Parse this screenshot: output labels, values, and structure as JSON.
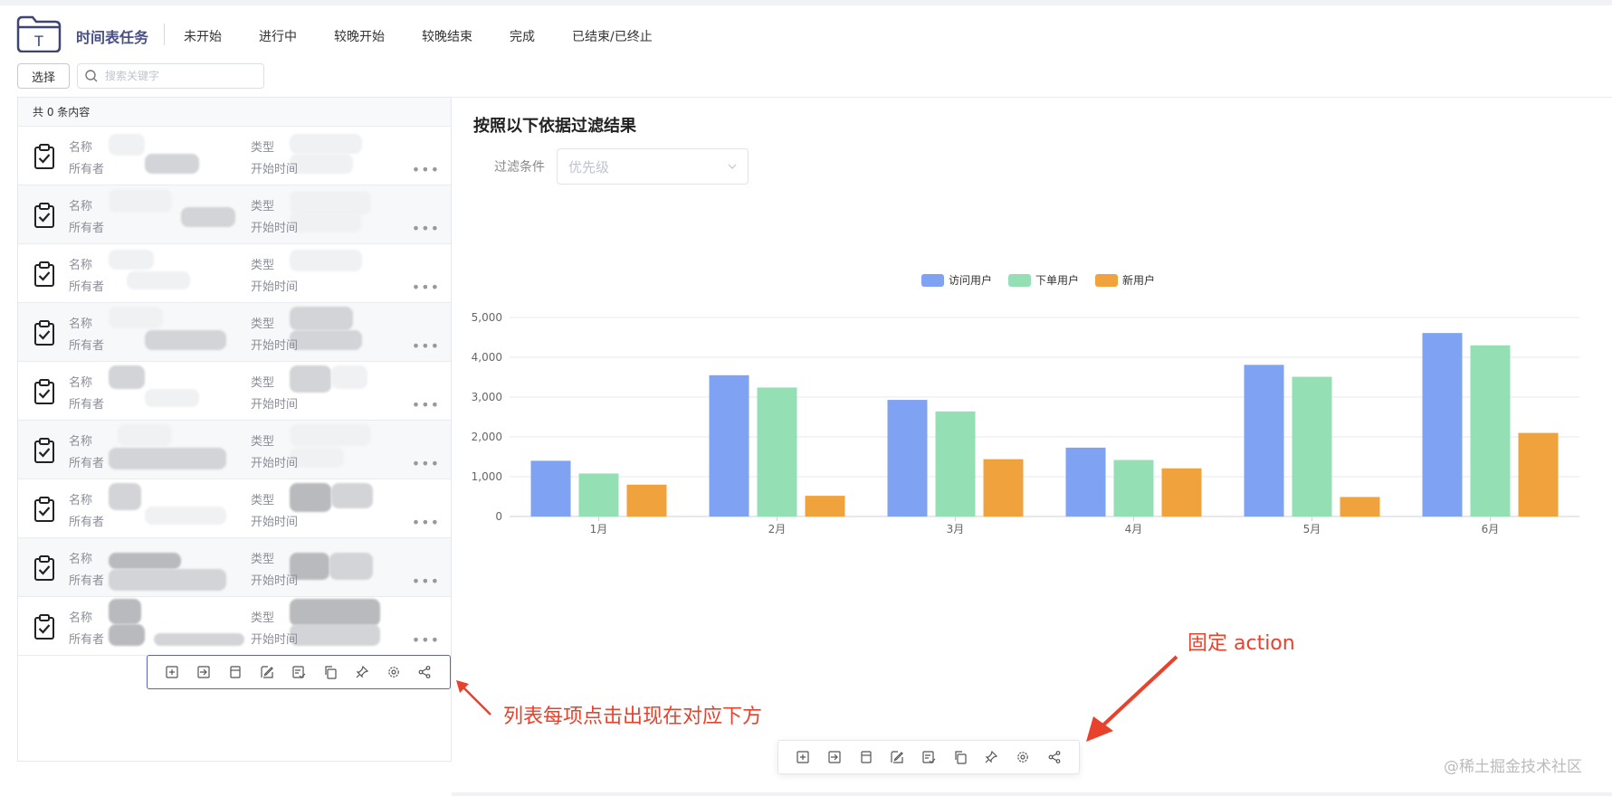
{
  "header": {
    "app_title": "时间表任务",
    "tabs": [
      "未开始",
      "进行中",
      "较晚开始",
      "较晚结束",
      "完成",
      "已结束/已终止"
    ]
  },
  "toolbar": {
    "select_label": "选择",
    "search_placeholder": "搜索关键字"
  },
  "list": {
    "count_text": "共 0 条内容",
    "labels": {
      "name": "名称",
      "type": "类型",
      "owner": "所有者",
      "start": "开始时间"
    },
    "item_count": 9
  },
  "actions": [
    "add-box-icon",
    "import-icon",
    "page-icon",
    "edit-icon",
    "review-icon",
    "copy-icon",
    "pin-icon",
    "settings-icon",
    "share-icon"
  ],
  "filter": {
    "title": "按照以下依据过滤结果",
    "label": "过滤条件",
    "placeholder": "优先级"
  },
  "chart_data": {
    "type": "bar",
    "categories": [
      "1月",
      "2月",
      "3月",
      "4月",
      "5月",
      "6月"
    ],
    "series": [
      {
        "name": "访问用户",
        "color": "#7fa2f3",
        "values": [
          1400,
          3550,
          2930,
          1730,
          3810,
          4610
        ]
      },
      {
        "name": "下单用户",
        "color": "#95dfb5",
        "values": [
          1080,
          3240,
          2640,
          1420,
          3510,
          4300
        ]
      },
      {
        "name": "新用户",
        "color": "#f0a33d",
        "values": [
          800,
          520,
          1440,
          1210,
          490,
          2100
        ]
      }
    ],
    "ylim": [
      0,
      5000
    ],
    "yticks": [
      "0",
      "1,000",
      "2,000",
      "3,000",
      "4,000",
      "5,000"
    ],
    "legend": "top-center",
    "grid": true
  },
  "annotations": {
    "list_note": "列表每项点击出现在对应下方",
    "fixed_note": "固定 action"
  },
  "watermark": "@稀土掘金技术社区"
}
